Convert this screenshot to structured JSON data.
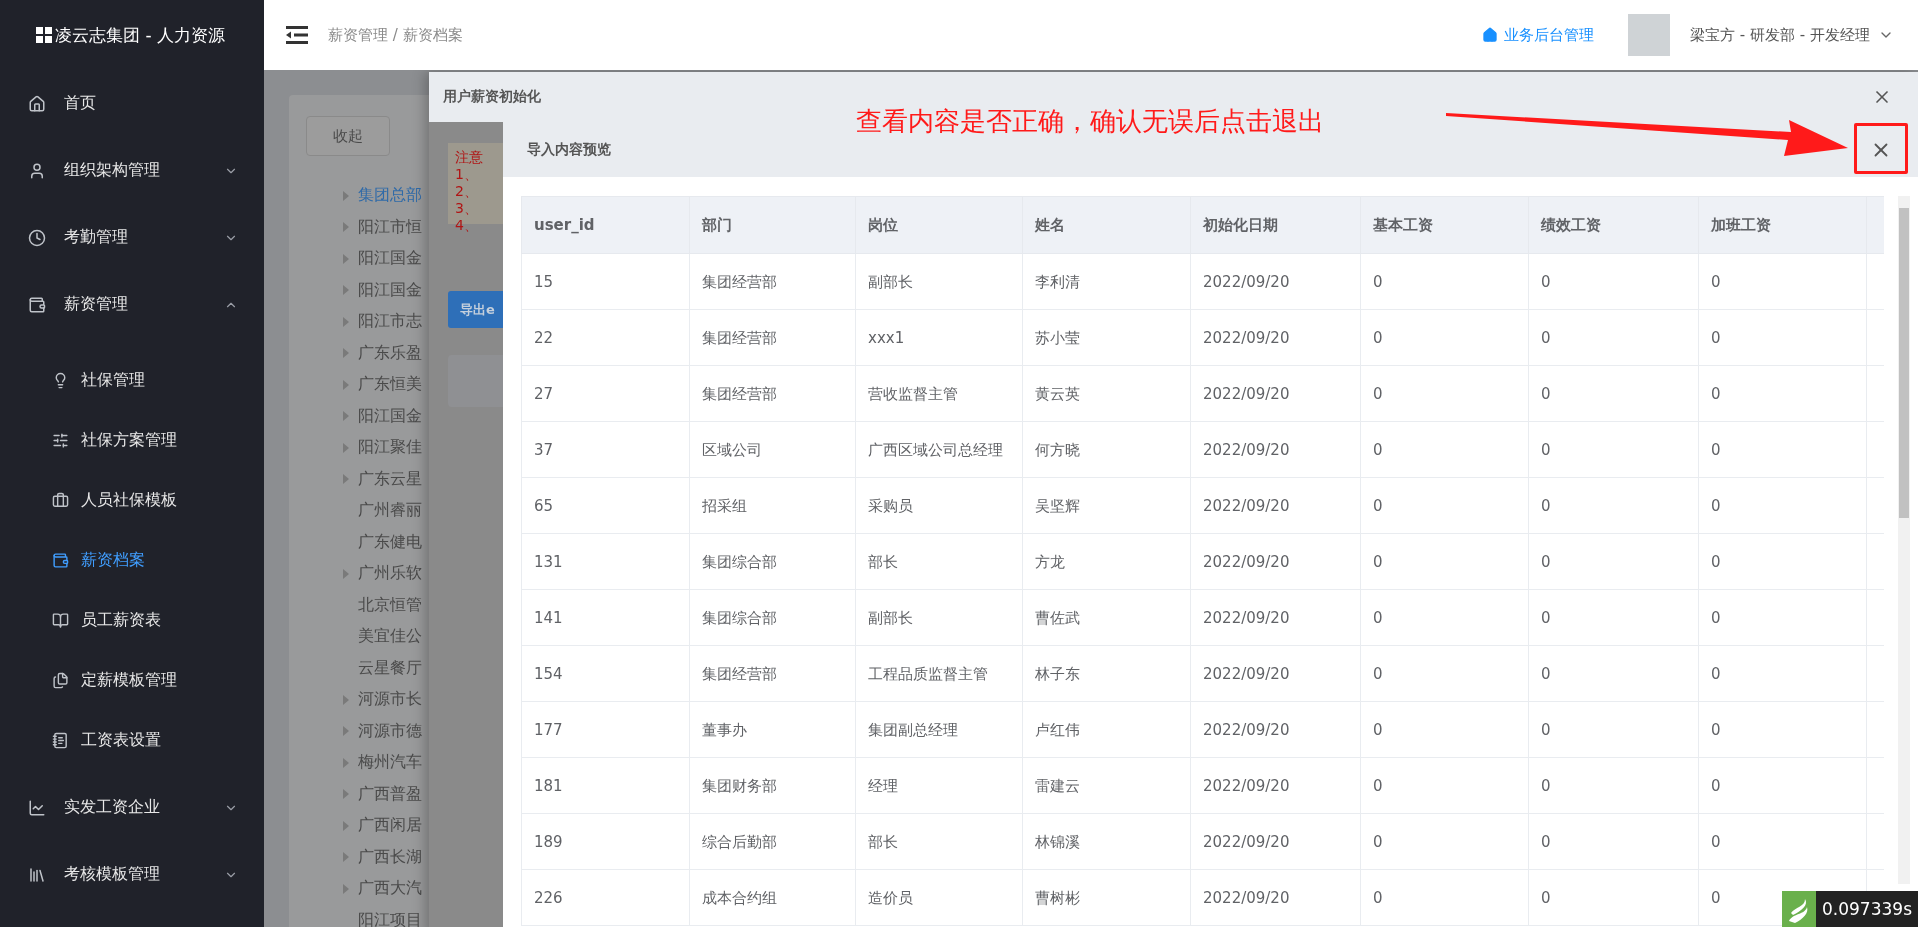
{
  "sidebar": {
    "brand": "凌云志集团 - 人力资源",
    "items": [
      {
        "label": "首页",
        "kind": "link"
      },
      {
        "label": "组织架构管理",
        "kind": "group",
        "expanded": false
      },
      {
        "label": "考勤管理",
        "kind": "group",
        "expanded": false
      },
      {
        "label": "薪资管理",
        "kind": "group",
        "expanded": true,
        "children": [
          {
            "label": "社保管理",
            "selected": false
          },
          {
            "label": "社保方案管理",
            "selected": false
          },
          {
            "label": "人员社保模板",
            "selected": false
          },
          {
            "label": "薪资档案",
            "selected": true
          },
          {
            "label": "员工薪资表",
            "selected": false
          },
          {
            "label": "定薪模板管理",
            "selected": false
          },
          {
            "label": "工资表设置",
            "selected": false
          }
        ]
      },
      {
        "label": "实发工资企业",
        "kind": "group",
        "expanded": false
      },
      {
        "label": "考核模板管理",
        "kind": "group",
        "expanded": false
      }
    ]
  },
  "header": {
    "breadcrumb": "薪资管理 / 薪资档案",
    "link": "业务后台管理",
    "user": "梁宝方 - 研发部 - 开发经理"
  },
  "background": {
    "collapse_button": "收起",
    "tree": [
      {
        "label": "集团总部",
        "has_children": true,
        "selected": true
      },
      {
        "label": "阳江市恒",
        "has_children": true,
        "selected": false
      },
      {
        "label": "阳江国金",
        "has_children": true,
        "selected": false
      },
      {
        "label": "阳江国金",
        "has_children": true,
        "selected": false
      },
      {
        "label": "阳江市志",
        "has_children": true,
        "selected": false
      },
      {
        "label": "广东乐盈",
        "has_children": true,
        "selected": false
      },
      {
        "label": "广东恒美",
        "has_children": true,
        "selected": false
      },
      {
        "label": "阳江国金",
        "has_children": true,
        "selected": false
      },
      {
        "label": "阳江聚佳",
        "has_children": true,
        "selected": false
      },
      {
        "label": "广东云星",
        "has_children": true,
        "selected": false
      },
      {
        "label": "广州睿丽",
        "has_children": false,
        "selected": false
      },
      {
        "label": "广东健电",
        "has_children": false,
        "selected": false
      },
      {
        "label": "广州乐软",
        "has_children": true,
        "selected": false
      },
      {
        "label": "北京恒管",
        "has_children": false,
        "selected": false
      },
      {
        "label": "美宜佳公",
        "has_children": false,
        "selected": false
      },
      {
        "label": "云星餐厅",
        "has_children": false,
        "selected": false
      },
      {
        "label": "河源市长",
        "has_children": true,
        "selected": false
      },
      {
        "label": "河源市德",
        "has_children": true,
        "selected": false
      },
      {
        "label": "梅州汽车",
        "has_children": true,
        "selected": false
      },
      {
        "label": "广西普盈",
        "has_children": true,
        "selected": false
      },
      {
        "label": "广西闲居",
        "has_children": true,
        "selected": false
      },
      {
        "label": "广西长湖",
        "has_children": true,
        "selected": false
      },
      {
        "label": "广西大汽",
        "has_children": true,
        "selected": false
      },
      {
        "label": "阳江项目",
        "has_children": false,
        "selected": false
      }
    ]
  },
  "dialog": {
    "title": "用户薪资初始化",
    "notice": {
      "title": "注意",
      "lines": [
        "1、",
        "2、",
        "3、",
        "4、"
      ]
    },
    "export_button": "导出e",
    "preview": {
      "title": "导入内容预览",
      "columns": [
        "user_id",
        "部门",
        "岗位",
        "姓名",
        "初始化日期",
        "基本工资",
        "绩效工资",
        "加班工资"
      ],
      "rows": [
        [
          "15",
          "集团经营部",
          "副部长",
          "李利清",
          "2022/09/20",
          "0",
          "0",
          "0"
        ],
        [
          "22",
          "集团经营部",
          "xxx1",
          "苏小莹",
          "2022/09/20",
          "0",
          "0",
          "0"
        ],
        [
          "27",
          "集团经营部",
          "营收监督主管",
          "黄云英",
          "2022/09/20",
          "0",
          "0",
          "0"
        ],
        [
          "37",
          "区域公司",
          "广西区域公司总经理",
          "何方晓",
          "2022/09/20",
          "0",
          "0",
          "0"
        ],
        [
          "65",
          "招采组",
          "采购员",
          "吴坚辉",
          "2022/09/20",
          "0",
          "0",
          "0"
        ],
        [
          "131",
          "集团综合部",
          "部长",
          "方龙",
          "2022/09/20",
          "0",
          "0",
          "0"
        ],
        [
          "141",
          "集团综合部",
          "副部长",
          "曹佐武",
          "2022/09/20",
          "0",
          "0",
          "0"
        ],
        [
          "154",
          "集团经营部",
          "工程品质监督主管",
          "林子东",
          "2022/09/20",
          "0",
          "0",
          "0"
        ],
        [
          "177",
          "董事办",
          "集团副总经理",
          "卢红伟",
          "2022/09/20",
          "0",
          "0",
          "0"
        ],
        [
          "181",
          "集团财务部",
          "经理",
          "雷建云",
          "2022/09/20",
          "0",
          "0",
          "0"
        ],
        [
          "189",
          "综合后勤部",
          "部长",
          "林锦溪",
          "2022/09/20",
          "0",
          "0",
          "0"
        ],
        [
          "226",
          "成本合约组",
          "造价员",
          "曹树彬",
          "2022/09/20",
          "0",
          "0",
          "0"
        ]
      ]
    }
  },
  "annotation": {
    "text": "查看内容是否正确，确认无误后点击退出"
  },
  "timer": "0.097339s"
}
